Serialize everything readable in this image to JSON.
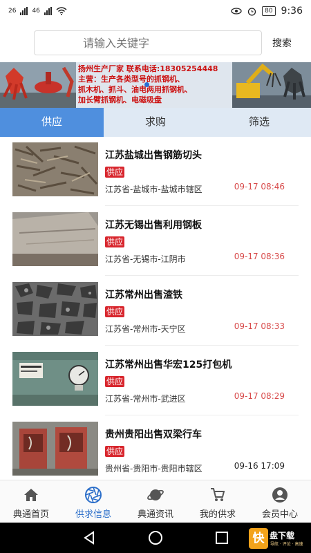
{
  "status": {
    "sig1": "26",
    "sig2": "46",
    "battery": "80",
    "time": "9:36"
  },
  "search": {
    "placeholder": "请输入关键字",
    "button": "搜索"
  },
  "banner": {
    "line1": "扬州生产厂家  联系电话:18305254448",
    "line2": "主营：生产各类型号的抓钢机、",
    "line3": "抓木机、抓斗、油电两用抓钢机、",
    "line4": "加长臂抓钢机、电磁吸盘"
  },
  "tabs": [
    "供应",
    "求购",
    "筛选"
  ],
  "listings": [
    {
      "title": "江苏盐城出售钢筋切头",
      "badge": "供应",
      "location": "江苏省-盐城市-盐城市辖区",
      "date": "09-17 08:46"
    },
    {
      "title": "江苏无锡出售利用钢板",
      "badge": "供应",
      "location": "江苏省-无锡市-江阴市",
      "date": "09-17 08:36"
    },
    {
      "title": "江苏常州出售渣铁",
      "badge": "供应",
      "location": "江苏省-常州市-天宁区",
      "date": "09-17 08:33"
    },
    {
      "title": "江苏常州出售华宏125打包机",
      "badge": "供应",
      "location": "江苏省-常州市-武进区",
      "date": "09-17 08:29"
    },
    {
      "title": "贵州贵阳出售双梁行车",
      "badge": "供应",
      "location": "贵州省-贵阳市-贵阳市辖区",
      "date": "09-16 17:09"
    }
  ],
  "nav": [
    "典通首页",
    "供求信息",
    "典通资讯",
    "我的供求",
    "会员中心"
  ],
  "watermark": {
    "logo": "快",
    "text": "盘下载",
    "sub": "导航 · 评论 · 高速"
  }
}
